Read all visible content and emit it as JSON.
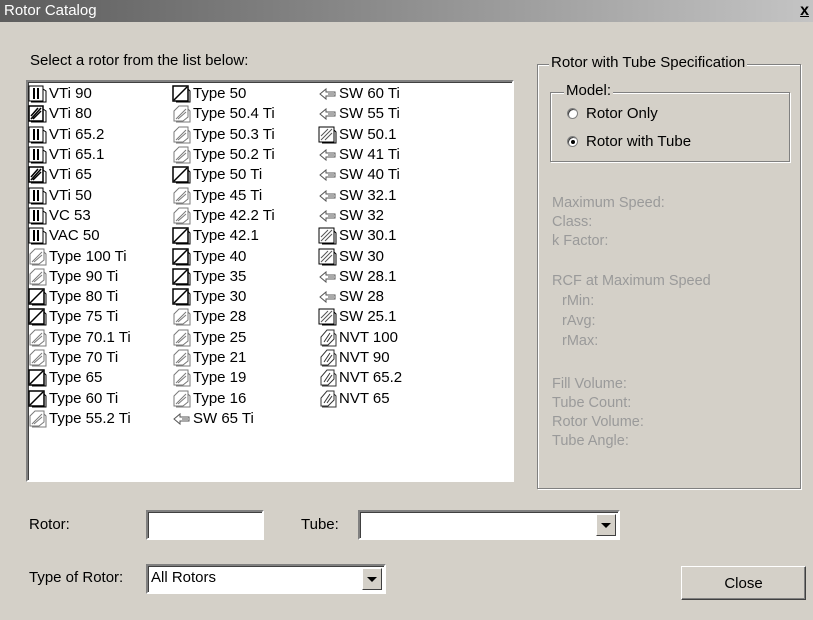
{
  "window": {
    "title": "Rotor Catalog",
    "close_glyph": "x"
  },
  "prompt": "Select a rotor from the list below:",
  "rotor_columns": [
    [
      {
        "label": "VTi 90",
        "icon": "vertical"
      },
      {
        "label": "VTi 80",
        "icon": "vertical-dark"
      },
      {
        "label": "VTi 65.2",
        "icon": "vertical"
      },
      {
        "label": "VTi 65.1",
        "icon": "vertical"
      },
      {
        "label": "VTi 65",
        "icon": "vertical-dark"
      },
      {
        "label": "VTi 50",
        "icon": "vertical"
      },
      {
        "label": "VC 53",
        "icon": "vertical"
      },
      {
        "label": "VAC 50",
        "icon": "vertical"
      },
      {
        "label": "Type 100 Ti",
        "icon": "fixed-light"
      },
      {
        "label": "Type 90 Ti",
        "icon": "fixed-light"
      },
      {
        "label": "Type 80 Ti",
        "icon": "fixed-dark"
      },
      {
        "label": "Type 75 Ti",
        "icon": "fixed-dark"
      },
      {
        "label": "Type 70.1 Ti",
        "icon": "fixed-light"
      },
      {
        "label": "Type 70 Ti",
        "icon": "fixed-light"
      },
      {
        "label": "Type 65",
        "icon": "fixed-dark"
      },
      {
        "label": "Type 60 Ti",
        "icon": "fixed-dark"
      },
      {
        "label": "Type 55.2 Ti",
        "icon": "fixed-light"
      }
    ],
    [
      {
        "label": "Type 50",
        "icon": "fixed-dark"
      },
      {
        "label": "Type 50.4 Ti",
        "icon": "fixed-light"
      },
      {
        "label": "Type 50.3 Ti",
        "icon": "fixed-light"
      },
      {
        "label": "Type 50.2 Ti",
        "icon": "fixed-light"
      },
      {
        "label": "Type 50 Ti",
        "icon": "fixed-dark"
      },
      {
        "label": "Type 45 Ti",
        "icon": "fixed-light"
      },
      {
        "label": "Type 42.2 Ti",
        "icon": "fixed-light"
      },
      {
        "label": "Type 42.1",
        "icon": "fixed-dark"
      },
      {
        "label": "Type 40",
        "icon": "fixed-dark"
      },
      {
        "label": "Type 35",
        "icon": "fixed-dark"
      },
      {
        "label": "Type 30",
        "icon": "fixed-dark"
      },
      {
        "label": "Type 28",
        "icon": "fixed-light"
      },
      {
        "label": "Type 25",
        "icon": "fixed-light"
      },
      {
        "label": "Type 21",
        "icon": "fixed-light"
      },
      {
        "label": "Type 19",
        "icon": "fixed-light"
      },
      {
        "label": "Type 16",
        "icon": "fixed-light"
      },
      {
        "label": "SW 65 Ti",
        "icon": "swing"
      }
    ],
    [
      {
        "label": "SW 60 Ti",
        "icon": "swing"
      },
      {
        "label": "SW 55 Ti",
        "icon": "swing"
      },
      {
        "label": "SW 50.1",
        "icon": "swing-box"
      },
      {
        "label": "SW 41 Ti",
        "icon": "swing"
      },
      {
        "label": "SW 40 Ti",
        "icon": "swing"
      },
      {
        "label": "SW 32.1",
        "icon": "swing"
      },
      {
        "label": "SW 32",
        "icon": "swing"
      },
      {
        "label": "SW 30.1",
        "icon": "swing-box"
      },
      {
        "label": "SW 30",
        "icon": "swing-box"
      },
      {
        "label": "SW 28.1",
        "icon": "swing"
      },
      {
        "label": "SW 28",
        "icon": "swing"
      },
      {
        "label": "SW 25.1",
        "icon": "swing-box"
      },
      {
        "label": "NVT 100",
        "icon": "near-vertical"
      },
      {
        "label": "NVT 90",
        "icon": "near-vertical"
      },
      {
        "label": "NVT 65.2",
        "icon": "near-vertical"
      },
      {
        "label": "NVT 65",
        "icon": "near-vertical"
      }
    ]
  ],
  "spec": {
    "group_title": "Rotor with Tube Specification",
    "model_title": "Model:",
    "model_options": [
      {
        "label": "Rotor Only",
        "selected": false
      },
      {
        "label": "Rotor with Tube",
        "selected": true
      }
    ],
    "fields_a": [
      "Maximum Speed:",
      "Class:",
      "k Factor:"
    ],
    "rcf_title": "RCF at Maximum Speed",
    "fields_rcf": [
      "rMin:",
      "rAvg:",
      "rMax:"
    ],
    "fields_b": [
      "Fill Volume:",
      "Tube Count:",
      "Rotor Volume:",
      "Tube Angle:"
    ]
  },
  "form": {
    "rotor_label": "Rotor:",
    "rotor_value": "",
    "tube_label": "Tube:",
    "tube_value": "",
    "type_label": "Type of Rotor:",
    "type_value": "All Rotors"
  },
  "close_button": "Close",
  "colors": {
    "disabled_text": "#9a9a9a",
    "face": "#d4d0c8"
  }
}
